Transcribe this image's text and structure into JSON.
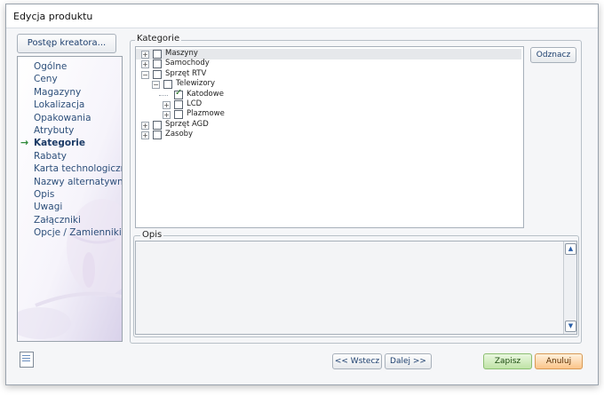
{
  "window": {
    "title": "Edycja produktu"
  },
  "wizard": {
    "progress_button": "Postęp kreatora...",
    "active_marker": "→",
    "steps": [
      {
        "label": "Ogólne"
      },
      {
        "label": "Ceny"
      },
      {
        "label": "Magazyny"
      },
      {
        "label": "Lokalizacja"
      },
      {
        "label": "Opakowania"
      },
      {
        "label": "Atrybuty"
      },
      {
        "label": "Kategorie",
        "active": true
      },
      {
        "label": "Rabaty"
      },
      {
        "label": "Karta technologiczna"
      },
      {
        "label": "Nazwy alternatywne"
      },
      {
        "label": "Opis"
      },
      {
        "label": "Uwagi"
      },
      {
        "label": "Załączniki"
      },
      {
        "label": "Opcje / Zamienniki"
      }
    ]
  },
  "categories": {
    "group_label": "Kategorie",
    "unmark_button": "Odznacz",
    "tree": [
      {
        "label": "Maszyny",
        "level": 0,
        "expander": "+",
        "checked": false,
        "selected": true
      },
      {
        "label": "Samochody",
        "level": 0,
        "expander": "+",
        "checked": false
      },
      {
        "label": "Sprzęt RTV",
        "level": 0,
        "expander": "−",
        "checked": false
      },
      {
        "label": "Telewizory",
        "level": 1,
        "expander": "−",
        "checked": false
      },
      {
        "label": "Katodowe",
        "level": 2,
        "expander": "",
        "checked": true
      },
      {
        "label": "LCD",
        "level": 2,
        "expander": "+",
        "checked": false
      },
      {
        "label": "Plazmowe",
        "level": 2,
        "expander": "+",
        "checked": false
      },
      {
        "label": "Sprzęt AGD",
        "level": 0,
        "expander": "+",
        "checked": false
      },
      {
        "label": "Zasoby",
        "level": 0,
        "expander": "+",
        "checked": false
      }
    ]
  },
  "description": {
    "group_label": "Opis",
    "value": ""
  },
  "footer": {
    "back_button": "<< Wstecz",
    "next_button": "Dalej >>",
    "save_button": "Zapisz",
    "cancel_button": "Anuluj"
  },
  "colors": {
    "active_marker": "#2f8a3a",
    "save": "#bfe3a6",
    "cancel": "#fbc489"
  }
}
